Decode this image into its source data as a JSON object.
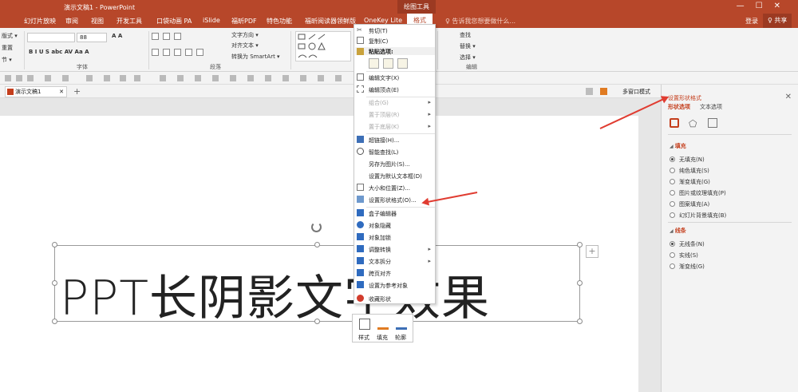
{
  "window": {
    "title": "演示文稿1 - PowerPoint",
    "context_tab_group": "绘图工具",
    "controls": [
      "—",
      "☐",
      "✕"
    ]
  },
  "menu": {
    "tabs": [
      "幻灯片放映",
      "审阅",
      "视图",
      "开发工具",
      "口袋动画 PA",
      "iSlide",
      "福昕PDF",
      "特色功能",
      "福昕阅读器领鲜版",
      "OneKey Lite",
      "格式"
    ],
    "tell_me": "♀ 告诉我您想要做什么...",
    "login": "登录",
    "share": "♀ 共享"
  },
  "ribbon": {
    "slide_items": [
      "版式 ▾",
      "重置",
      "节 ▾"
    ],
    "font_name": "",
    "font_size": "88",
    "font_group": "字体",
    "paragraph_items": [
      "文字方向 ▾",
      "对齐文本 ▾",
      "转换为 SmartArt ▾"
    ],
    "paragraph_group": "段落",
    "edit_items": [
      "查找",
      "替换 ▾",
      "选择 ▾"
    ],
    "edit_group": "编辑"
  },
  "doc_tab": {
    "name": "演示文稿1",
    "close": "✕",
    "add": "+",
    "multi_window": "多窗口模式"
  },
  "slide": {
    "text": "PPT长阴影文字效果"
  },
  "context_menu": {
    "cut": "剪切(T)",
    "copy": "复制(C)",
    "paste_options": "粘贴选项:",
    "edit_text": "编辑文字(X)",
    "edit_points": "编辑顶点(E)",
    "group": "组合(G)",
    "bring_front": "置于顶层(R)",
    "send_back": "置于底层(K)",
    "hyperlink": "超链接(H)...",
    "smart_lookup": "智能查找(L)",
    "save_as_picture": "另存为图片(S)...",
    "set_default_textbox": "设置为默认文本框(D)",
    "size_position": "大小和位置(Z)...",
    "format_shape": "设置形状格式(O)...",
    "box_editor": "盒子编辑器",
    "hide_object": "对象隐藏",
    "lock_object": "对象加锁",
    "adjust_convert": "调整转换",
    "text_split": "文本拆分",
    "cross_page_align": "跨页对齐",
    "set_reference": "设置为参考对象",
    "collect_shape": "收藏形状"
  },
  "mini_toolbar": {
    "style": "样式",
    "fill": "填充",
    "outline": "轮廓"
  },
  "format_pane": {
    "title": "设置形状格式",
    "tab_shape": "形状选项",
    "tab_text": "文本选项",
    "close": "✕",
    "fill_section": "填充",
    "fill_options": [
      "无填充(N)",
      "纯色填充(S)",
      "渐变填充(G)",
      "图片或纹理填充(P)",
      "图案填充(A)",
      "幻灯片背景填充(B)"
    ],
    "fill_selected": 0,
    "line_section": "线条",
    "line_options": [
      "无线条(N)",
      "实线(S)",
      "渐变线(G)"
    ],
    "line_selected": 0
  },
  "colors": {
    "accent": "#b7472a",
    "arrow": "#e03c31"
  }
}
